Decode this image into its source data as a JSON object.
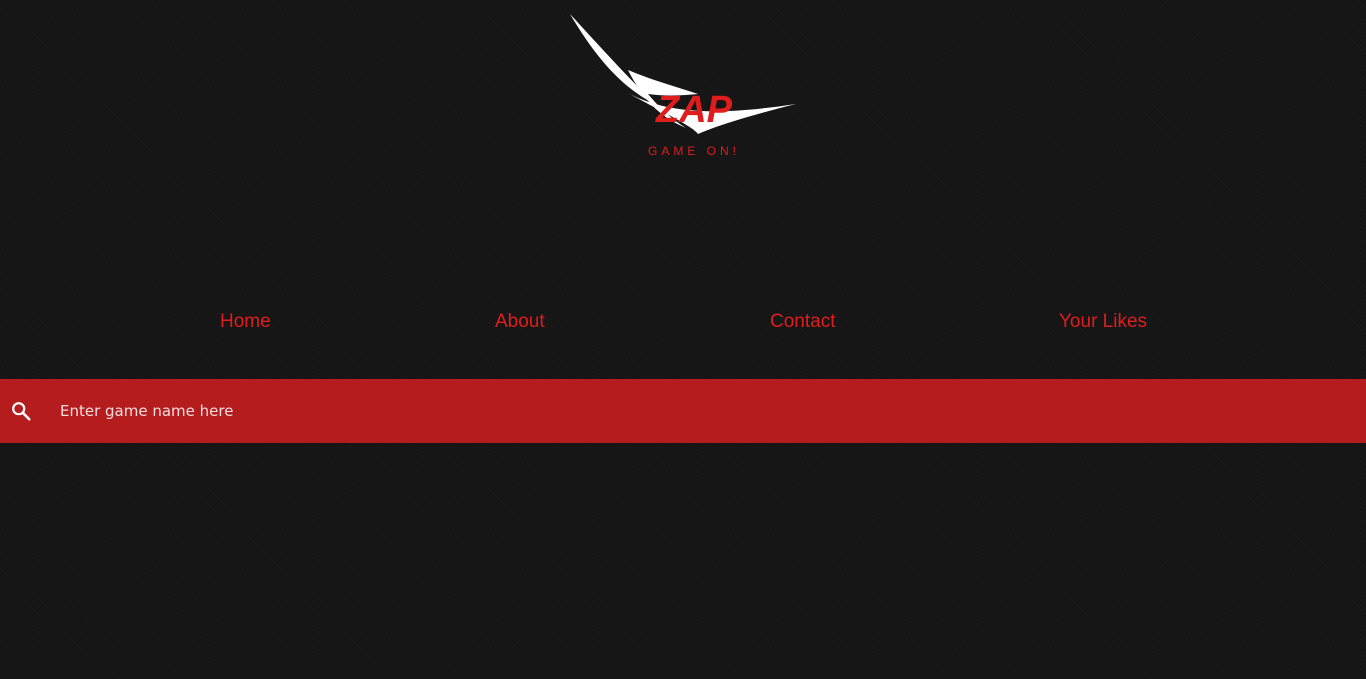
{
  "brand": {
    "name": "ZAP",
    "tagline": "GAME ON!",
    "accent_color": "#e01d1d",
    "logo_icon": "white-swoosh"
  },
  "nav": {
    "items": [
      {
        "label": "Home"
      },
      {
        "label": "About"
      },
      {
        "label": "Contact"
      },
      {
        "label": "Your Likes"
      }
    ]
  },
  "search": {
    "icon": "search-icon",
    "placeholder": "Enter game name here",
    "value": "",
    "bar_color": "#b51c1d"
  }
}
